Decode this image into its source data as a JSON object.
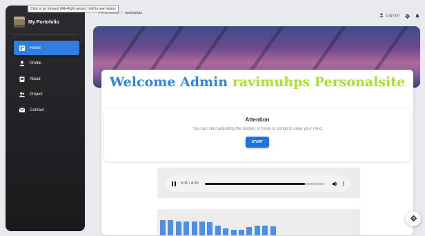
{
  "tooltip": "Click to go forward (Alt+Right arrow), hold to see history",
  "brand": {
    "name": "My Portofolio"
  },
  "nav": [
    {
      "label": "Home",
      "icon": "home-icon",
      "active": true
    },
    {
      "label": "Profile",
      "icon": "user-icon",
      "active": false
    },
    {
      "label": "About",
      "icon": "document-icon",
      "active": false
    },
    {
      "label": "Project",
      "icon": "users-icon",
      "active": false
    },
    {
      "label": "Contact",
      "icon": "mail-icon",
      "active": false
    }
  ],
  "breadcrumb": {
    "root": "Personalsite",
    "separator": "/",
    "current": "ravimuhps"
  },
  "topbar": {
    "logout_label": "Log Out"
  },
  "welcome": {
    "prefix": "Welcome Admin ",
    "highlight": "ravimuhps Personalsite"
  },
  "attention": {
    "title": "Attention",
    "message": "You can start adjusting the display or listen to songs to clear your mind",
    "button_label": "START"
  },
  "player": {
    "time": "0:11 / 4:20",
    "progress": 0.84
  },
  "visualizer": {
    "levels": [
      0.9,
      0.9,
      0.85,
      0.85,
      0.85,
      0.85,
      0.8,
      0.6,
      0.4,
      0.35,
      0.35,
      0.5,
      0.6,
      0.6,
      0.55
    ]
  },
  "colors": {
    "accent": "#2f7ee0",
    "welcome_blue": "#2f85e0",
    "welcome_green": "#a8e230",
    "bar": "#4d8ee6"
  }
}
